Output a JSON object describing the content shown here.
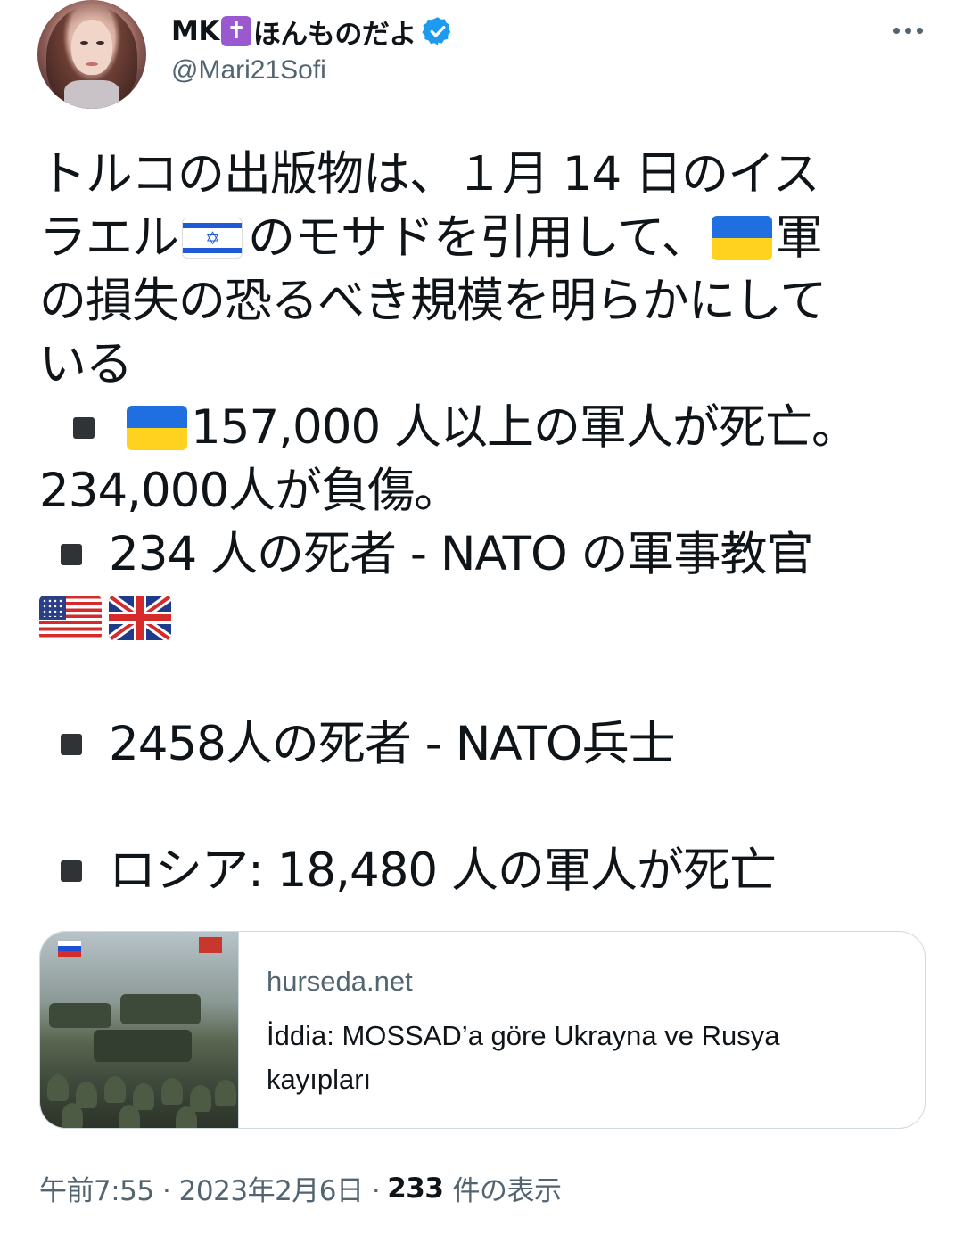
{
  "author": {
    "name_prefix": "MK",
    "name_symbol": "✝",
    "name_suffix": "ほんものだよ",
    "handle": "@Mari21Sofi",
    "verified": true,
    "avatar_icon": "avatar-portrait-icon"
  },
  "tweet": {
    "line1": "トルコの出版物は、１月 14 日のイス",
    "line2_a": "ラエル",
    "line2_b": "のモサドを引用して、",
    "line2_c": "軍",
    "line3": "の損失の恐るべき規模を明らかにして",
    "line4": "いる",
    "bullet1_a": "157,000 人以上の軍人が死亡。",
    "bullet1_b": "234,000人が負傷。",
    "bullet2": "234 人の死者 - NATO の軍事教官",
    "bullet3": "2458人の死者 - NATO兵士",
    "bullet4": "ロシア: 18,480 人の軍人が死亡"
  },
  "link_card": {
    "domain": "hurseda.net",
    "title": "İddia: MOSSAD’a göre Ukrayna ve Rusya kayıpları"
  },
  "meta": {
    "time": "午前7:55 · 2023年2月6日 ·",
    "views_count": "233",
    "views_label": "件の表示"
  },
  "colors": {
    "text": "#0f1419",
    "secondary": "#536471",
    "verified": "#1d9bf0",
    "border": "#cfd9de"
  }
}
